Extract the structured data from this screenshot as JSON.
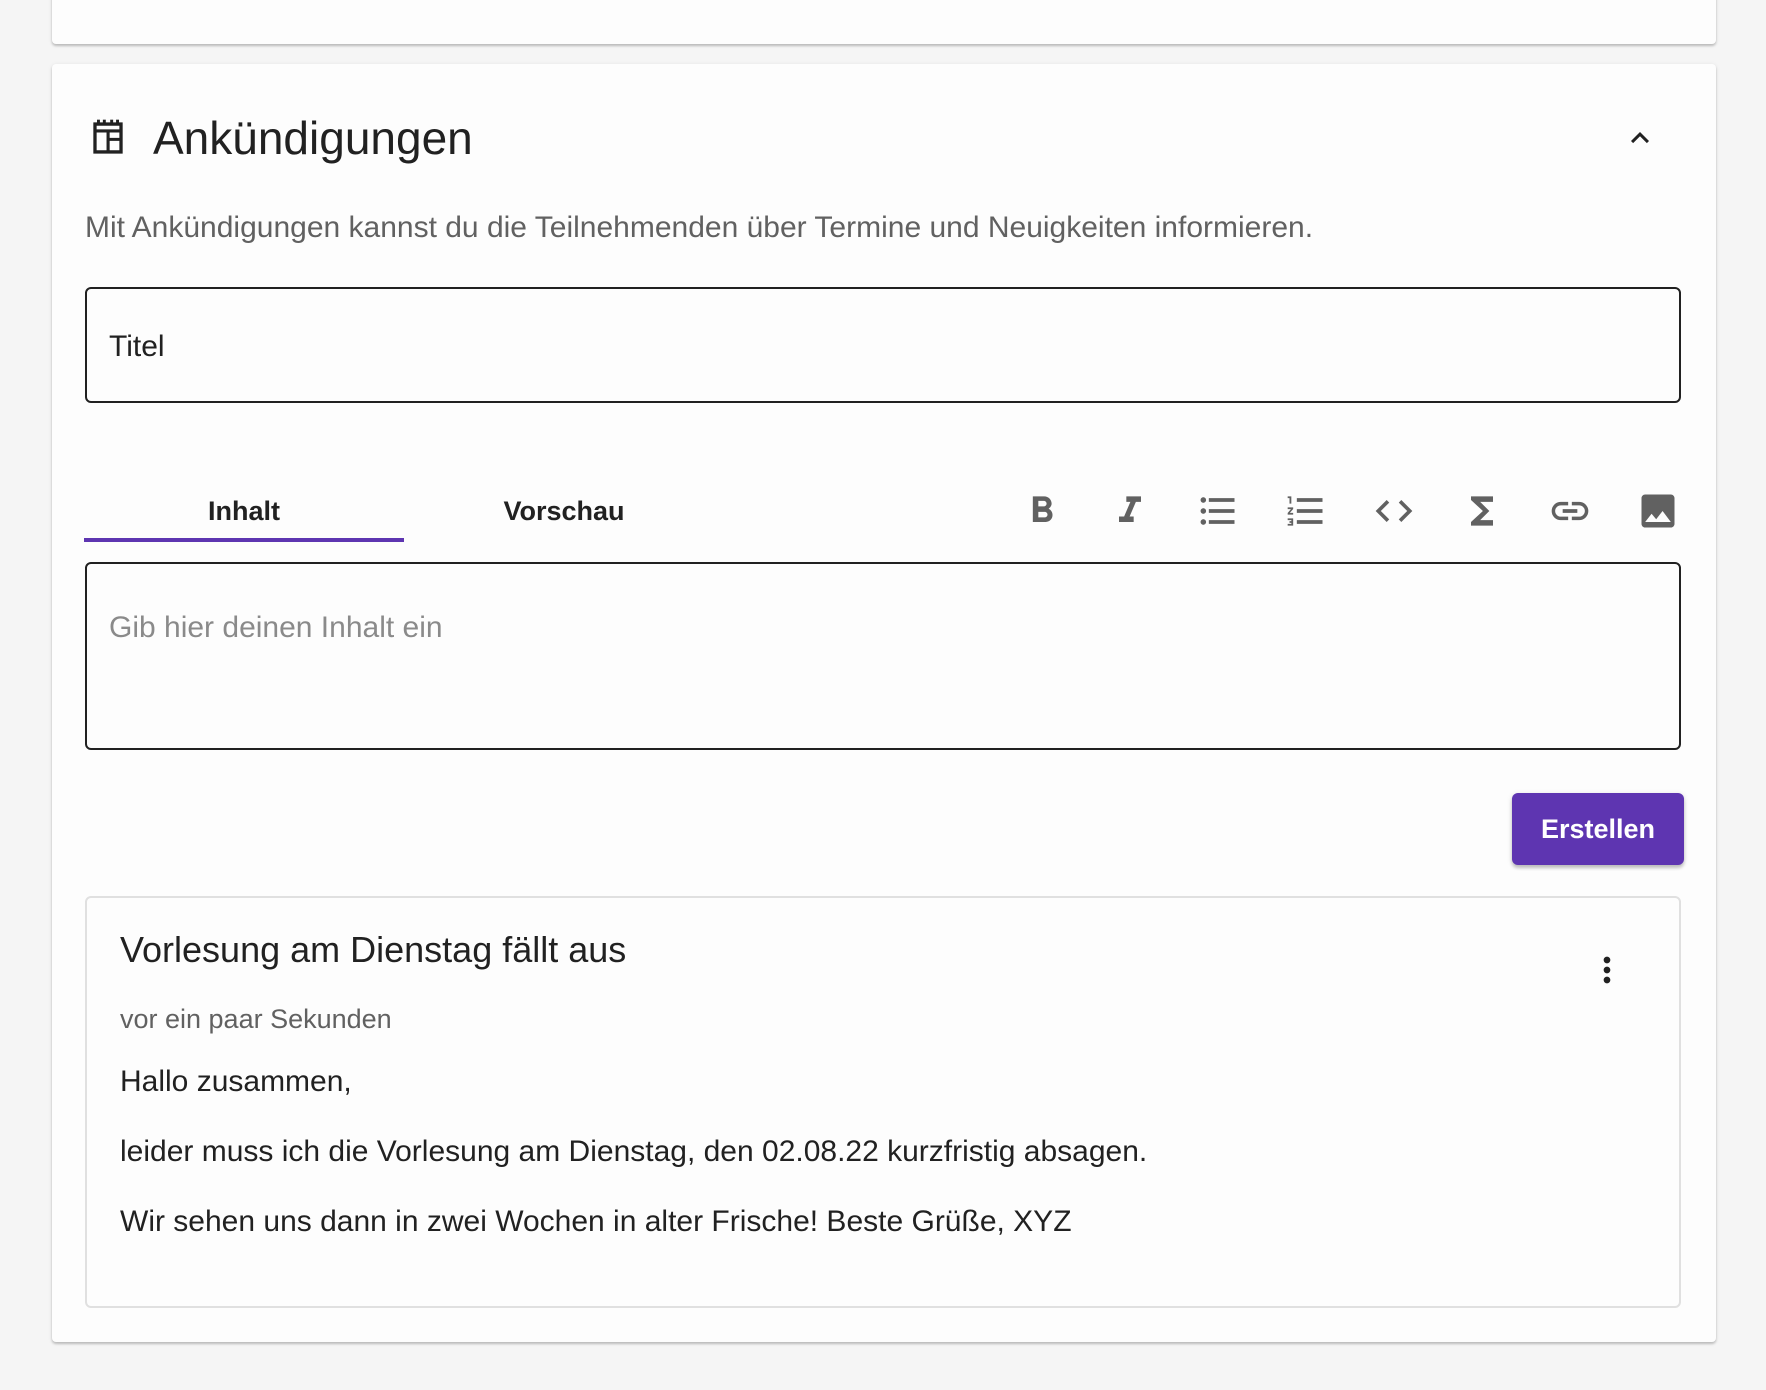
{
  "section": {
    "title": "Ankündigungen",
    "description": "Mit Ankündigungen kannst du die Teilnehmenden über Termine und Neuigkeiten informieren.",
    "header_icon": "announcement-calendar-icon",
    "collapse_icon": "chevron-up-icon"
  },
  "form": {
    "title_label": "Titel",
    "tabs": [
      {
        "label": "Inhalt",
        "active": true
      },
      {
        "label": "Vorschau",
        "active": false
      }
    ],
    "toolbar": [
      "bold-icon",
      "italic-icon",
      "bulleted-list-icon",
      "numbered-list-icon",
      "code-icon",
      "sigma-icon",
      "link-icon",
      "image-icon"
    ],
    "content_placeholder": "Gib hier deinen Inhalt ein",
    "submit_label": "Erstellen"
  },
  "announcements": [
    {
      "title": "Vorlesung am Dienstag fällt aus",
      "time": "vor ein paar Sekunden",
      "paragraphs": [
        "Hallo zusammen,",
        "leider muss ich die Vorlesung am Dienstag, den 02.08.22 kurzfristig absagen.",
        "Wir sehen uns dann in zwei Wochen in alter Frische! Beste Grüße, XYZ"
      ],
      "menu_icon": "more-vert-icon"
    }
  ],
  "colors": {
    "accent": "#5e35b1",
    "background": "#f5f5f5",
    "card": "#fdfdfd",
    "text": "#212121",
    "muted": "#616161"
  }
}
